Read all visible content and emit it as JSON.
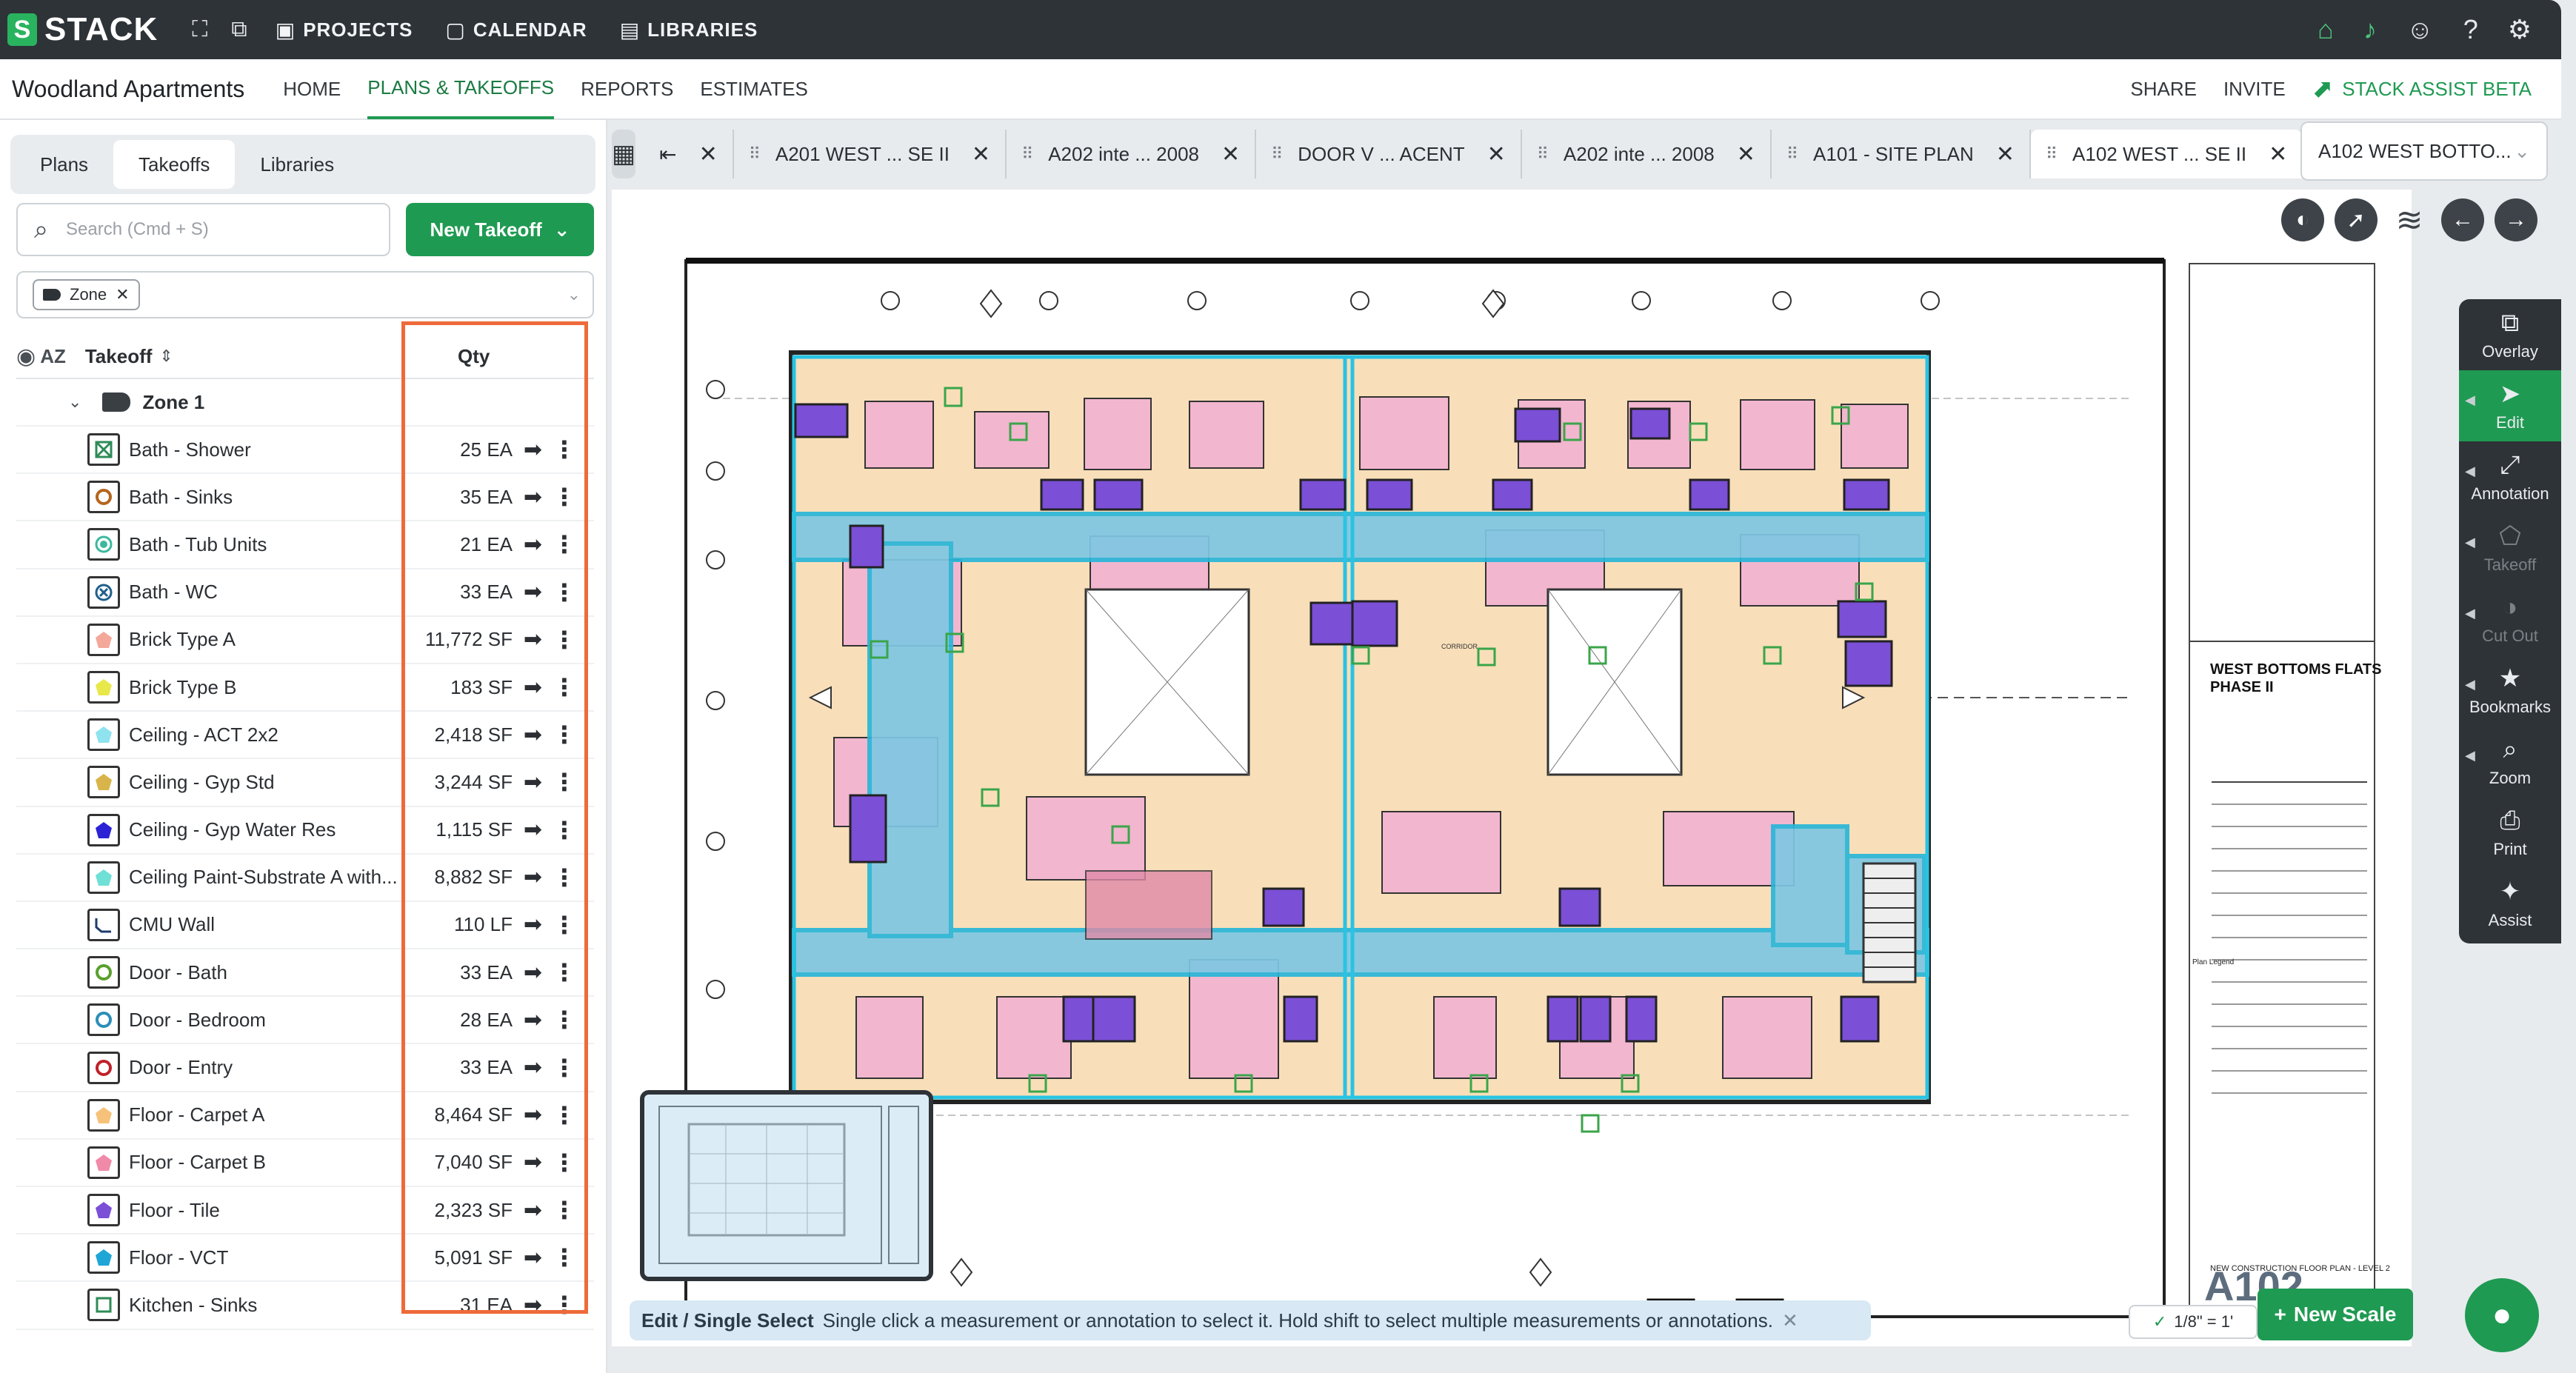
{
  "topbar": {
    "brand": "STACK",
    "nav": [
      {
        "label": "PROJECTS",
        "icon": "briefcase-icon"
      },
      {
        "label": "CALENDAR",
        "icon": "calendar-icon"
      },
      {
        "label": "LIBRARIES",
        "icon": "library-icon"
      }
    ]
  },
  "project": {
    "name": "Woodland Apartments",
    "nav": [
      "HOME",
      "PLANS & TAKEOFFS",
      "REPORTS",
      "ESTIMATES"
    ],
    "active_nav": "PLANS & TAKEOFFS",
    "right": {
      "share": "SHARE",
      "invite": "INVITE",
      "assist": "STACK ASSIST BETA"
    }
  },
  "left": {
    "tabs": [
      "Plans",
      "Takeoffs",
      "Libraries"
    ],
    "active_tab": "Takeoffs",
    "search_placeholder": "Search (Cmd + S)",
    "new_takeoff": "New Takeoff",
    "filter_chip": "Zone",
    "col_az": "AZ",
    "col_takeoff": "Takeoff",
    "col_qty": "Qty",
    "zone": "Zone 1",
    "items": [
      {
        "name": "Bath - Shower",
        "qty": "25 EA",
        "color": "#2e8b57",
        "shape": "xbox"
      },
      {
        "name": "Bath - Sinks",
        "qty": "35 EA",
        "color": "#b5651d",
        "shape": "ring"
      },
      {
        "name": "Bath - Tub Units",
        "qty": "21 EA",
        "color": "#3cb89e",
        "shape": "dot"
      },
      {
        "name": "Bath - WC",
        "qty": "33 EA",
        "color": "#1e5f8a",
        "shape": "xcircle"
      },
      {
        "name": "Brick Type A",
        "qty": "11,772 SF",
        "color": "#f4a89a",
        "shape": "penta"
      },
      {
        "name": "Brick Type B",
        "qty": "183 SF",
        "color": "#e8e84a",
        "shape": "penta"
      },
      {
        "name": "Ceiling - ACT 2x2",
        "qty": "2,418 SF",
        "color": "#8fe3ef",
        "shape": "penta"
      },
      {
        "name": "Ceiling - Gyp Std",
        "qty": "3,244 SF",
        "color": "#d8b44a",
        "shape": "penta"
      },
      {
        "name": "Ceiling - Gyp Water Res",
        "qty": "1,115 SF",
        "color": "#2b22d6",
        "shape": "penta"
      },
      {
        "name": "Ceiling Paint-Substrate A with...",
        "qty": "8,882 SF",
        "color": "#6fe0d6",
        "shape": "penta"
      },
      {
        "name": "CMU Wall",
        "qty": "110 LF",
        "color": "#1e3c6e",
        "shape": "line"
      },
      {
        "name": "Door - Bath",
        "qty": "33 EA",
        "color": "#5aa02c",
        "shape": "ring"
      },
      {
        "name": "Door - Bedroom",
        "qty": "28 EA",
        "color": "#2a8fb8",
        "shape": "ring"
      },
      {
        "name": "Door - Entry",
        "qty": "33 EA",
        "color": "#c0202a",
        "shape": "ring"
      },
      {
        "name": "Floor - Carpet A",
        "qty": "8,464 SF",
        "color": "#f6c27a",
        "shape": "penta"
      },
      {
        "name": "Floor - Carpet B",
        "qty": "7,040 SF",
        "color": "#f08aa8",
        "shape": "penta"
      },
      {
        "name": "Floor - Tile",
        "qty": "2,323 SF",
        "color": "#7b4fd6",
        "shape": "penta"
      },
      {
        "name": "Floor - VCT",
        "qty": "5,091 SF",
        "color": "#1fa6d6",
        "shape": "penta"
      },
      {
        "name": "Kitchen - Sinks",
        "qty": "31 EA",
        "color": "#2e8b57",
        "shape": "square"
      }
    ]
  },
  "sheets": {
    "tabs": [
      "A201 WEST ... SE II",
      "A202 inte ... 2008",
      "DOOR V ... ACENT",
      "A202 inte ... 2008",
      "A101 - SITE PLAN",
      "A102 WEST ... SE II"
    ],
    "active": "A102 WEST ... SE II",
    "selector": "A102 WEST BOTTO..."
  },
  "plan": {
    "title_block": "WEST BOTTOMS FLATS\nPHASE II",
    "sheet_number": "A102",
    "sheet_title": "NEW CONSTRUCTION FLOOR PLAN - LEVEL 2",
    "legend_title": "Plan Legend",
    "corridor": "CORRIDOR"
  },
  "rail": [
    {
      "label": "Overlay",
      "icon": "overlay-icon"
    },
    {
      "label": "Edit",
      "icon": "cursor-icon",
      "active": true
    },
    {
      "label": "Annotation",
      "icon": "annotation-icon"
    },
    {
      "label": "Takeoff",
      "icon": "takeoff-icon",
      "disabled": true
    },
    {
      "label": "Cut Out",
      "icon": "cutout-icon",
      "disabled": true
    },
    {
      "label": "Bookmarks",
      "icon": "star-icon"
    },
    {
      "label": "Zoom",
      "icon": "zoom-icon"
    },
    {
      "label": "Print",
      "icon": "print-icon"
    },
    {
      "label": "Assist",
      "icon": "sparkle-icon"
    }
  ],
  "helpbar": {
    "mode": "Edit / Single Select",
    "text": "Single click a measurement or annotation to select it. Hold shift to select multiple measurements or annotations."
  },
  "scale": "1/8\" = 1'",
  "new_scale": "New Scale"
}
